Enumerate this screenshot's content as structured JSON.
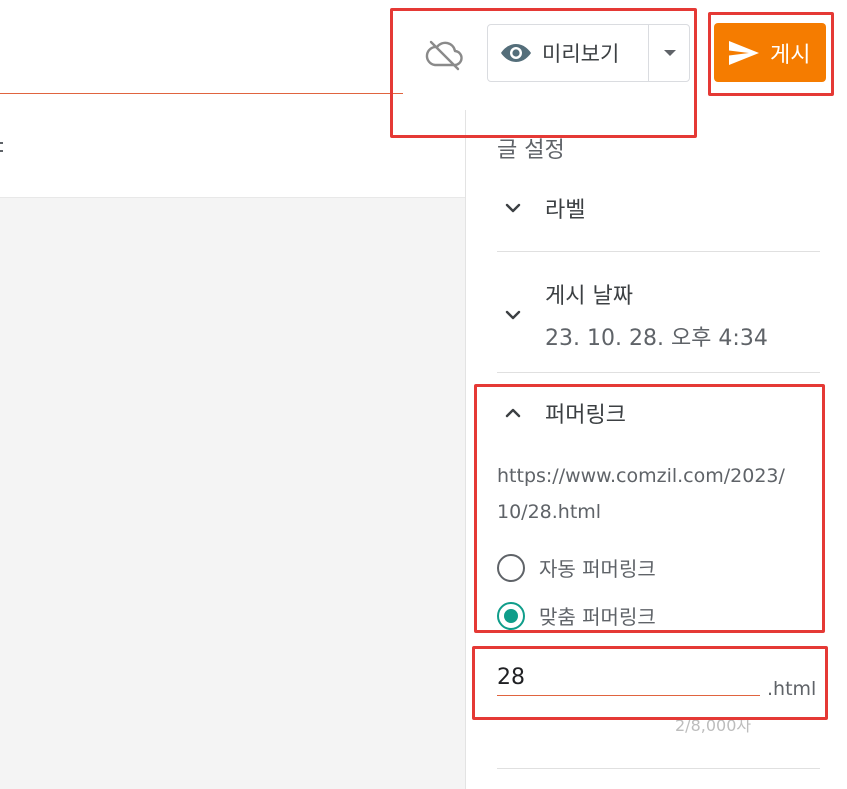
{
  "toolbar": {
    "sync_icon": "cloud-off-icon",
    "preview_label": "미리보기",
    "preview_icon": "eye-icon",
    "preview_dropdown_icon": "caret-down-icon",
    "publish_label": "게시",
    "publish_icon": "send-icon",
    "publish_color": "#f57c00"
  },
  "sidebar": {
    "title": "글 설정",
    "sections": {
      "labels": {
        "label": "라벨",
        "icon": "chevron-down-icon"
      },
      "publish_date": {
        "label": "게시 날짜",
        "value": "23. 10. 28. 오후 4:34",
        "icon": "chevron-down-icon"
      },
      "permalink": {
        "label": "퍼머링크",
        "icon": "chevron-up-icon",
        "url_line1": "https://www.comzil.com/2023/",
        "url_line2": "10/28.html",
        "options": [
          {
            "label": "자동 퍼머링크",
            "selected": false
          },
          {
            "label": "맞춤 퍼머링크",
            "selected": true
          }
        ],
        "custom_value": "28",
        "suffix": ".html",
        "char_count": "2/8,000자"
      }
    }
  },
  "colors": {
    "accent": "#f57c00",
    "radio_checked": "#0f9d8a",
    "highlight": "#e53935",
    "input_underline": "#e0643f"
  }
}
